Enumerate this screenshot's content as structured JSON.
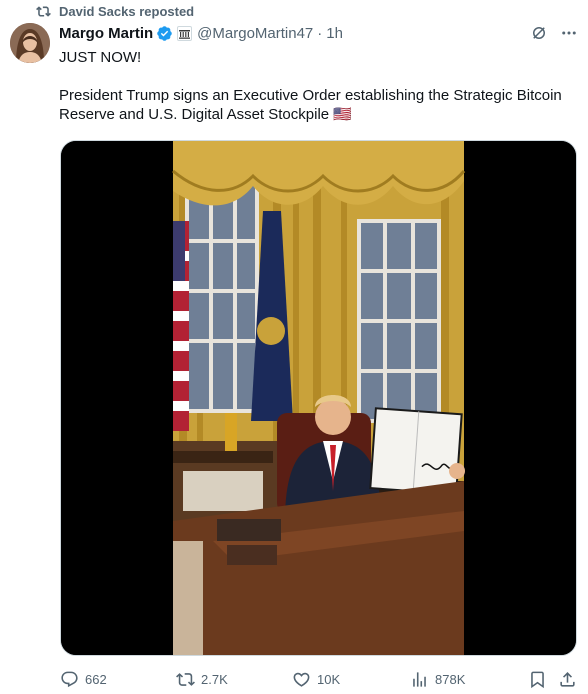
{
  "repost": {
    "label": "David Sacks reposted"
  },
  "author": {
    "name": "Margo Martin",
    "handle": "@MargoMartin47",
    "time": "1h"
  },
  "tweet": {
    "line1": "JUST NOW!",
    "line2": "President Trump signs an Executive Order establishing the Strategic Bitcoin",
    "line3": "Reserve and U.S. Digital Asset Stockpile",
    "flag": "🇺🇸"
  },
  "actions": {
    "replies": "662",
    "reposts": "2.7K",
    "likes": "10K",
    "views": "878K"
  },
  "colors": {
    "text": "#0f1419",
    "muted": "#536471",
    "verified": "#1d9bf0"
  },
  "icons": [
    "retweet-icon",
    "verified-icon",
    "affiliate-badge-icon",
    "grok-icon",
    "more-icon",
    "reply-icon",
    "like-icon",
    "views-icon",
    "bookmark-icon",
    "share-icon"
  ]
}
